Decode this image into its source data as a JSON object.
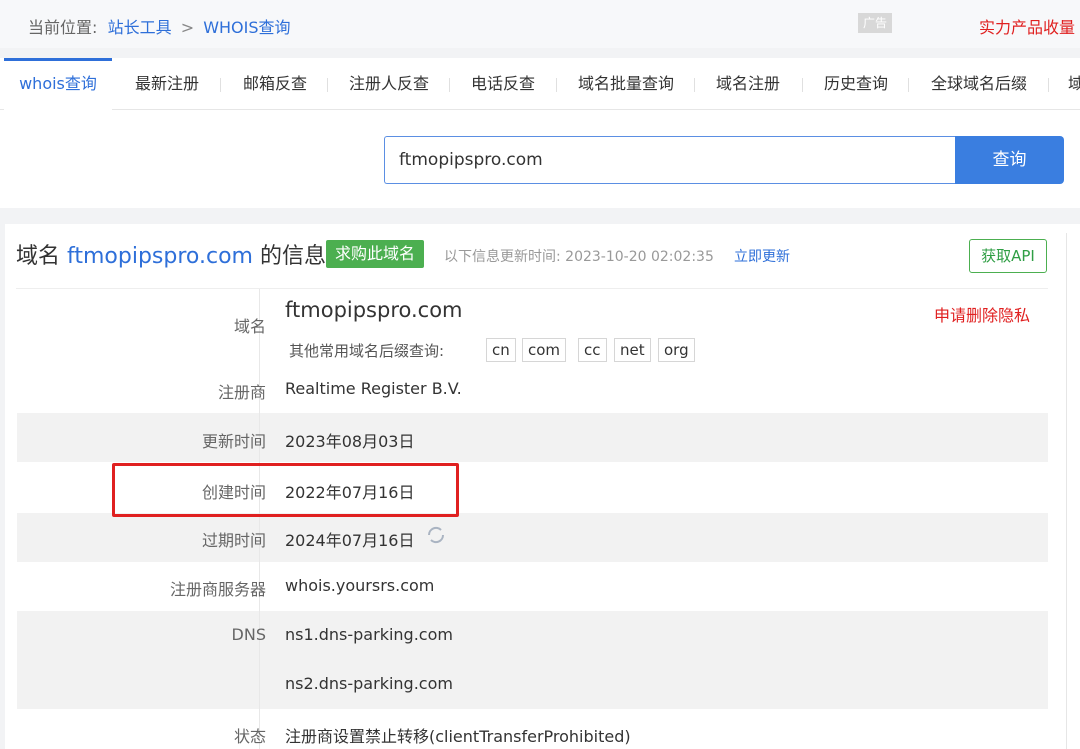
{
  "breadcrumb": {
    "prefix": "当前位置:",
    "tools": "站长工具",
    "sep": ">",
    "current": "WHOIS查询"
  },
  "ad": {
    "badge": "广告",
    "promo": "实力产品收量"
  },
  "tabs": [
    {
      "label": "whois查询"
    },
    {
      "label": "最新注册"
    },
    {
      "label": "邮箱反查"
    },
    {
      "label": "注册人反查"
    },
    {
      "label": "电话反查"
    },
    {
      "label": "域名批量查询"
    },
    {
      "label": "域名注册"
    },
    {
      "label": "历史查询"
    },
    {
      "label": "全球域名后缀"
    },
    {
      "label": "域"
    }
  ],
  "search": {
    "value": "ftmopipspro.com",
    "button": "查询"
  },
  "info": {
    "title_prefix": "域名",
    "title_domain": "ftmopipspro.com",
    "title_suffix": "的信息",
    "buy": "求购此域名",
    "update_label": "以下信息更新时间: 2023-10-20 02:02:35",
    "update_link": "立即更新",
    "api": "获取API",
    "privacy": "申请删除隐私"
  },
  "rows": {
    "domain": {
      "label": "域名",
      "value": "ftmopipspro.com",
      "sub_label": "其他常用域名后缀查询:",
      "suffixes": [
        "cn",
        "com",
        "cc",
        "net",
        "org"
      ]
    },
    "registrar": {
      "label": "注册商",
      "value": "Realtime Register B.V."
    },
    "updated": {
      "label": "更新时间",
      "value": "2023年08月03日"
    },
    "created": {
      "label": "创建时间",
      "value": "2022年07月16日"
    },
    "expires": {
      "label": "过期时间",
      "value": "2024年07月16日"
    },
    "server": {
      "label": "注册商服务器",
      "value": "whois.yoursrs.com"
    },
    "dns": {
      "label": "DNS",
      "values": [
        "ns1.dns-parking.com",
        "ns2.dns-parking.com"
      ]
    },
    "status": {
      "label": "状态",
      "value": "注册商设置禁止转移(clientTransferProhibited)"
    }
  },
  "colors": {
    "accent": "#2e6fd9",
    "buy_green": "#4caf50",
    "highlight_red": "#e02020"
  }
}
